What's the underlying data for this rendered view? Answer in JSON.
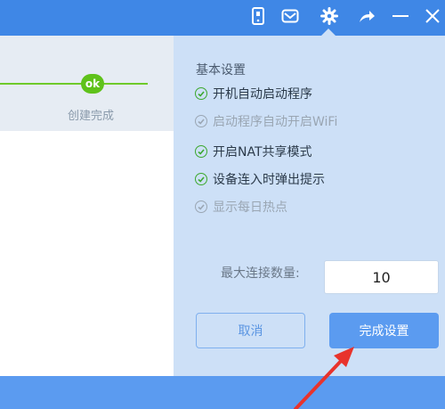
{
  "titlebar": {
    "icons": [
      "phone-icon",
      "mail-icon",
      "gear-icon",
      "share-icon",
      "minimize-icon",
      "close-icon"
    ]
  },
  "wizard": {
    "ok_badge": "ok",
    "step_label": "创建完成"
  },
  "settings": {
    "title": "基本设置",
    "options": [
      {
        "label": "开机自动启动程序",
        "checked": true,
        "enabled": true
      },
      {
        "label": "启动程序自动开启WiFi",
        "checked": true,
        "enabled": false
      },
      {
        "label": "开启NAT共享模式",
        "checked": true,
        "enabled": true
      },
      {
        "label": "设备连入时弹出提示",
        "checked": true,
        "enabled": true
      },
      {
        "label": "显示每日热点",
        "checked": true,
        "enabled": false
      }
    ],
    "max_connections_label": "最大连接数量:",
    "max_connections_value": "10",
    "cancel_label": "取消",
    "done_label": "完成设置"
  },
  "colors": {
    "titlebar": "#3f87e6",
    "panel": "#cde0f7",
    "primary_button": "#5b9bf0",
    "check_green": "#3ca82e",
    "progress_green": "#6fca2a",
    "annotation_arrow": "#e8332c"
  }
}
